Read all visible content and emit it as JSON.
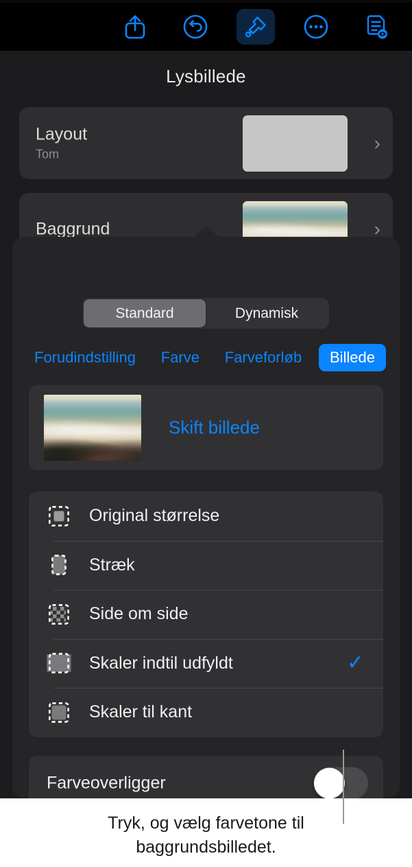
{
  "toolbar": {
    "buttons": [
      {
        "name": "share-icon",
        "label": "Del"
      },
      {
        "name": "undo-icon",
        "label": "Fortryd"
      },
      {
        "name": "format-brush-icon",
        "label": "Format",
        "active": true
      },
      {
        "name": "more-icon",
        "label": "Mere"
      },
      {
        "name": "document-view-icon",
        "label": "Dokumentvisning"
      }
    ]
  },
  "inspector": {
    "title": "Lysbillede",
    "layout_row": {
      "title": "Layout",
      "subtitle": "Tom",
      "chevron": "›"
    },
    "background_row": {
      "title": "Baggrund",
      "chevron": "›"
    }
  },
  "popover": {
    "segmented": {
      "options": [
        "Standard",
        "Dynamisk"
      ],
      "selected": "Standard"
    },
    "tabs": [
      {
        "label": "Forudindstilling",
        "selected": false
      },
      {
        "label": "Farve",
        "selected": false
      },
      {
        "label": "Farveforløb",
        "selected": false
      },
      {
        "label": "Billede",
        "selected": true
      }
    ],
    "picker": {
      "label": "Skift billede",
      "thumbnail": "beach-photo"
    },
    "scale_options": [
      {
        "label": "Original størrelse",
        "icon": "original-size-icon",
        "checked": false
      },
      {
        "label": "Stræk",
        "icon": "stretch-icon",
        "checked": false
      },
      {
        "label": "Side om side",
        "icon": "tile-icon",
        "checked": false
      },
      {
        "label": "Skaler indtil udfyldt",
        "icon": "scale-to-fill-icon",
        "checked": true
      },
      {
        "label": "Skaler til kant",
        "icon": "scale-to-fit-icon",
        "checked": false
      }
    ],
    "checkmark": "✓",
    "color_overlay": {
      "label": "Farveoverligger",
      "enabled": false
    }
  },
  "callout": {
    "text": "Tryk, og vælg farvetone til baggrundsbilledet."
  },
  "colors": {
    "accent_blue": "#0b84ff",
    "panel_bg": "#1c1c1e",
    "popover_bg": "#252527",
    "card_bg": "#2e2e30",
    "toolbar_bg": "#000000",
    "caption_bg": "#ffffff"
  }
}
